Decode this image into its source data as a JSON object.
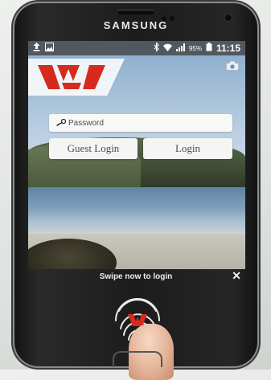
{
  "device": {
    "brand": "SAMSUNG"
  },
  "statusbar": {
    "battery_percent": "95%",
    "time": "11:15"
  },
  "app": {
    "brand_color": "#d52b1e",
    "password_placeholder": "Password",
    "guest_login_label": "Guest Login",
    "login_label": "Login"
  },
  "overlay": {
    "swipe_text": "Swipe now to login",
    "close_label": "✕"
  }
}
